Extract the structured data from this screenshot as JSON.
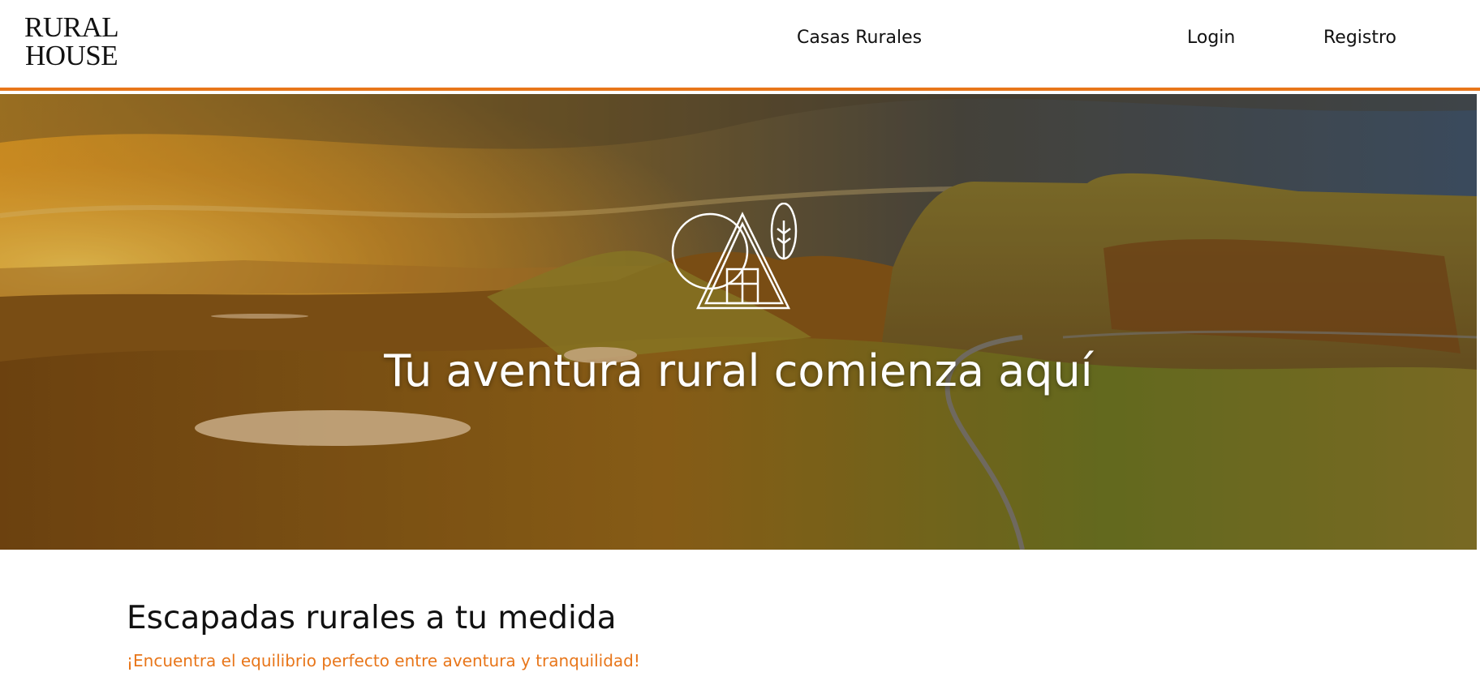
{
  "brand": {
    "line1": "RURAL",
    "line2": "HOUSE"
  },
  "nav": {
    "casas_rurales": "Casas Rurales",
    "login": "Login",
    "registro": "Registro"
  },
  "hero": {
    "title": "Tu aventura rural comienza aquí"
  },
  "section": {
    "title": "Escapadas rurales a tu medida",
    "subtitle": "¡Encuentra el equilibrio perfecto entre aventura y tranquilidad!"
  },
  "colors": {
    "accent": "#e8761a",
    "text": "#111111",
    "hero_text": "#ffffff"
  },
  "icons": {
    "hero": "cabin-tree-sun-icon"
  }
}
